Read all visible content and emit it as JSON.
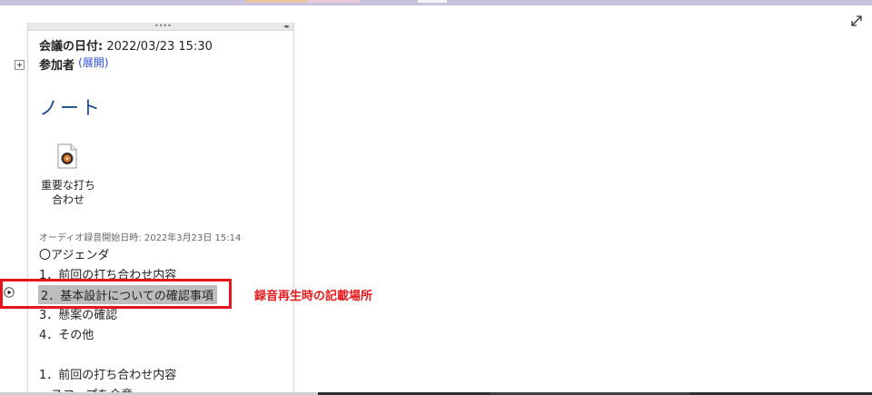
{
  "note": {
    "meeting_date_label": "会議の日付:",
    "meeting_date_value": "2022/03/23 15:30",
    "participants_label": "参加者",
    "participants_expand": "(展開)",
    "section_title": "ノート",
    "attachment": {
      "label_line1": "重要な打ち",
      "label_line2": "合わせ",
      "icon": "audio-file-icon"
    },
    "audio_start": "オーディオ録音開始日時: 2022年3月23日 15:14",
    "lines": [
      "〇アジェンダ",
      "1．前回の打ち合わせ内容",
      "2．基本設計についての確認事項",
      "3．懸案の確認",
      "4．その他",
      "1．前回の打ち合わせ内容",
      "・スコープを合意"
    ]
  },
  "annotation": {
    "text": "録音再生時の記載場所",
    "color": "#e31a1c"
  },
  "colors": {
    "title_blue": "#1d4a8a",
    "link_blue": "#2b4fd0",
    "highlight_gray": "#bdbdbd",
    "box_red": "#e8141b"
  }
}
